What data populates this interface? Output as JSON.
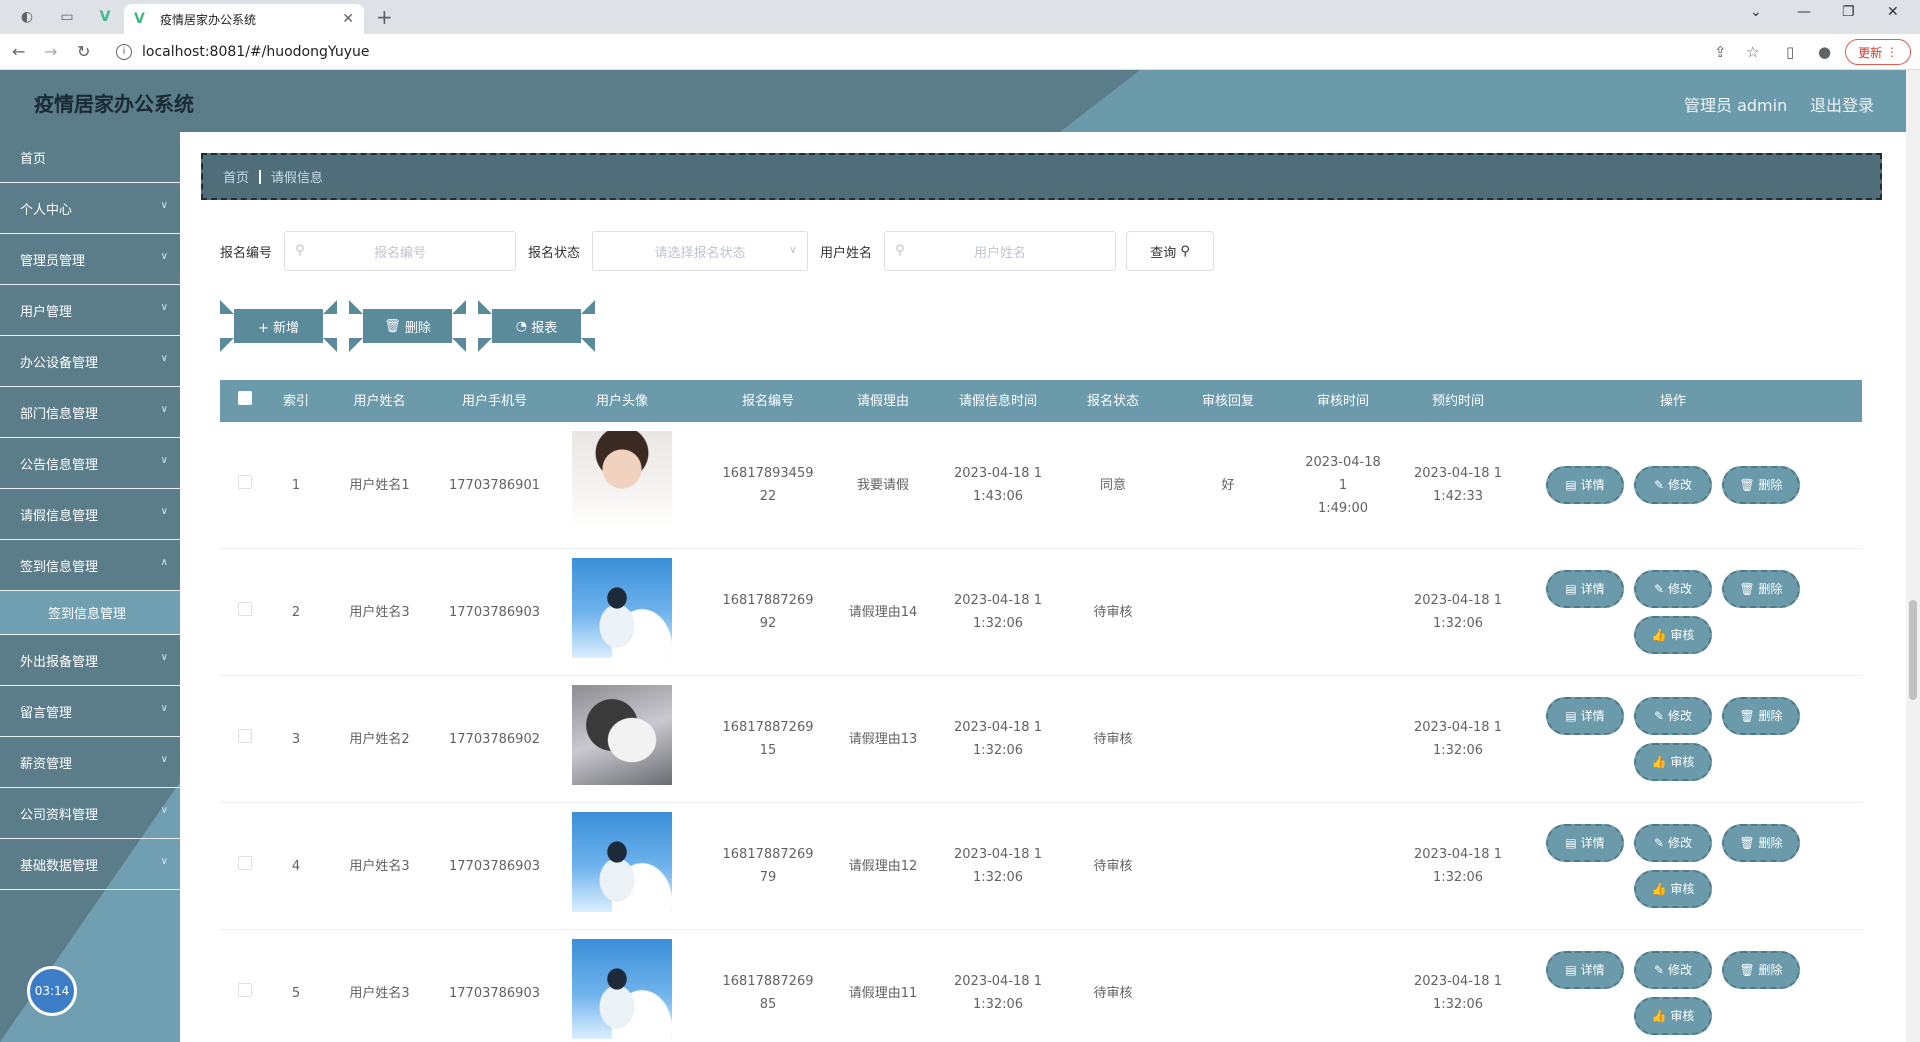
{
  "browser": {
    "tab_title": "疫情居家办公系统",
    "url": "localhost:8081/#/huodongYuyue",
    "update_label": "更新"
  },
  "header": {
    "title": "疫情居家办公系统",
    "user": "管理员 admin",
    "logout": "退出登录"
  },
  "sidebar": {
    "items": [
      {
        "label": "首页"
      },
      {
        "label": "个人中心"
      },
      {
        "label": "管理员管理"
      },
      {
        "label": "用户管理"
      },
      {
        "label": "办公设备管理"
      },
      {
        "label": "部门信息管理"
      },
      {
        "label": "公告信息管理"
      },
      {
        "label": "请假信息管理"
      },
      {
        "label": "签到信息管理"
      },
      {
        "label": "外出报备管理"
      },
      {
        "label": "留言管理"
      },
      {
        "label": "薪资管理"
      },
      {
        "label": "公司资料管理"
      },
      {
        "label": "基础数据管理"
      }
    ],
    "submenu_label": "签到信息管理",
    "clock": "03:14"
  },
  "breadcrumb": {
    "home": "首页",
    "current": "请假信息"
  },
  "search": {
    "label_no": "报名编号",
    "placeholder_no": "报名编号",
    "label_status": "报名状态",
    "placeholder_status": "请选择报名状态",
    "label_name": "用户姓名",
    "placeholder_name": "用户姓名",
    "query": "查询"
  },
  "actions": {
    "add": "+ 新增",
    "delete": "删除",
    "report": "报表"
  },
  "table": {
    "headers": [
      "索引",
      "用户姓名",
      "用户手机号",
      "用户头像",
      "报名编号",
      "请假理由",
      "请假信息时间",
      "报名状态",
      "审核回复",
      "审核时间",
      "预约时间",
      "操作"
    ],
    "ops": {
      "detail": "详情",
      "edit": "修改",
      "delete": "删除",
      "audit": "审核"
    },
    "rows": [
      {
        "index": "1",
        "name": "用户姓名1",
        "phone": "17703786901",
        "avatar": "portrait-man",
        "no_a": "16817893459",
        "no_b": "22",
        "reason": "我要请假",
        "time_a": "2023-04-18 1",
        "time_b": "1:43:06",
        "status": "同意",
        "reply": "好",
        "audit_a": "2023-04-18 1",
        "audit_b": "1:49:00",
        "appt_a": "2023-04-18 1",
        "appt_b": "1:42:33"
      },
      {
        "index": "2",
        "name": "用户姓名3",
        "phone": "17703786903",
        "avatar": "sky-boy",
        "no_a": "16817887269",
        "no_b": "92",
        "reason": "请假理由14",
        "time_a": "2023-04-18 1",
        "time_b": "1:32:06",
        "status": "待审核",
        "reply": "",
        "audit_a": "",
        "audit_b": "",
        "appt_a": "2023-04-18 1",
        "appt_b": "1:32:06"
      },
      {
        "index": "3",
        "name": "用户姓名2",
        "phone": "17703786902",
        "avatar": "husky",
        "no_a": "16817887269",
        "no_b": "15",
        "reason": "请假理由13",
        "time_a": "2023-04-18 1",
        "time_b": "1:32:06",
        "status": "待审核",
        "reply": "",
        "audit_a": "",
        "audit_b": "",
        "appt_a": "2023-04-18 1",
        "appt_b": "1:32:06"
      },
      {
        "index": "4",
        "name": "用户姓名3",
        "phone": "17703786903",
        "avatar": "sky-boy",
        "no_a": "16817887269",
        "no_b": "79",
        "reason": "请假理由12",
        "time_a": "2023-04-18 1",
        "time_b": "1:32:06",
        "status": "待审核",
        "reply": "",
        "audit_a": "",
        "audit_b": "",
        "appt_a": "2023-04-18 1",
        "appt_b": "1:32:06"
      },
      {
        "index": "5",
        "name": "用户姓名3",
        "phone": "17703786903",
        "avatar": "sky-boy",
        "no_a": "16817887269",
        "no_b": "85",
        "reason": "请假理由11",
        "time_a": "2023-04-18 1",
        "time_b": "1:32:06",
        "status": "待审核",
        "reply": "",
        "audit_a": "",
        "audit_b": "",
        "appt_a": "2023-04-18 1",
        "appt_b": "1:32:06"
      }
    ]
  }
}
